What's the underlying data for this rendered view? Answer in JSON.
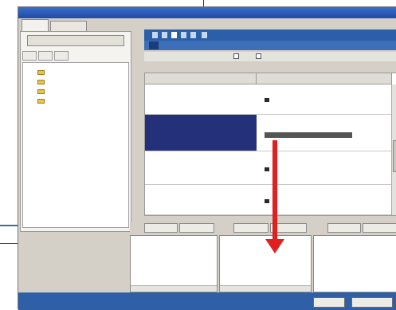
{
  "window": {
    "title": ""
  },
  "tabs": [
    {
      "label": "",
      "active": true
    },
    {
      "label": "",
      "active": false
    }
  ],
  "left_panel": {
    "button_label": "",
    "subtabs": [
      "",
      "",
      ""
    ],
    "tree_items": [
      {
        "label": ""
      },
      {
        "label": ""
      },
      {
        "label": ""
      },
      {
        "label": ""
      }
    ]
  },
  "alpha_index": [
    "",
    "",
    "",
    "",
    "",
    ""
  ],
  "filter": {
    "option1": "",
    "option2": ""
  },
  "table": {
    "headers": {
      "name": "",
      "email": ""
    },
    "rows": [
      {
        "name": "",
        "email": "",
        "selected": false
      },
      {
        "name": "",
        "email": "",
        "selected": true
      },
      {
        "name": "",
        "email": "",
        "selected": false
      },
      {
        "name": "",
        "email": "",
        "selected": false
      }
    ]
  },
  "bottom_panels": [
    {
      "label": "",
      "btn1": "",
      "btn2": "",
      "content": ""
    },
    {
      "label": "",
      "btn1": "",
      "btn2": "",
      "content": ""
    },
    {
      "label": "",
      "btn1": "",
      "btn2": "",
      "content": ""
    }
  ],
  "footer": {
    "ok": "",
    "cancel": ""
  },
  "annotation": {
    "color": "#e02020"
  },
  "colors": {
    "accent": "#2b5fa8",
    "selected_row": "#25307a",
    "folder": "#e8c44a"
  }
}
